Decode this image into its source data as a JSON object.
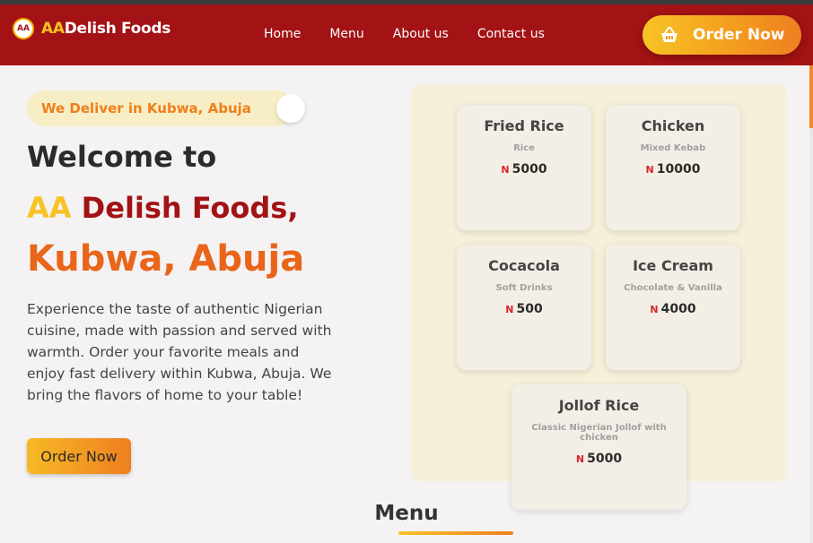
{
  "brand": {
    "logo_text": "AA",
    "name_prefix": "AA",
    "name_rest": "Delish Foods"
  },
  "nav": {
    "links": [
      "Home",
      "Menu",
      "About us",
      "Contact us"
    ],
    "order_label": "Order Now"
  },
  "hero": {
    "deliver_badge": "We Deliver in Kubwa, Abuja",
    "welcome": "Welcome to",
    "brand_prefix": "AA",
    "brand_rest": "Delish Foods,",
    "city": "Kubwa, Abuja",
    "description": "Experience the taste of authentic Nigerian cuisine, made with passion and served with warmth. Order your favorite meals and enjoy fast delivery within Kubwa, Abuja. We bring the flavors of home to your table!",
    "order_label": "Order Now"
  },
  "menu_cards": [
    {
      "name": "Fried Rice",
      "category": "Rice",
      "currency": "N",
      "price": "5000"
    },
    {
      "name": "Chicken",
      "category": "Mixed Kebab",
      "currency": "N",
      "price": "10000"
    },
    {
      "name": "Cocacola",
      "category": "Soft Drinks",
      "currency": "N",
      "price": "500"
    },
    {
      "name": "Ice Cream",
      "category": "Chocolate & Vanilla",
      "currency": "N",
      "price": "4000"
    },
    {
      "name": "Jollof Rice",
      "category": "Classic Nigerian Jollof with chicken",
      "currency": "N",
      "price": "5000"
    }
  ],
  "section": {
    "menu_title": "Menu"
  },
  "colors": {
    "primary": "#a31214",
    "accent_yellow": "#f7c325",
    "accent_orange": "#ef7f22",
    "city_orange": "#e9651a"
  },
  "icons": {
    "logo": "brand-logo-icon",
    "basket": "basket-icon"
  }
}
